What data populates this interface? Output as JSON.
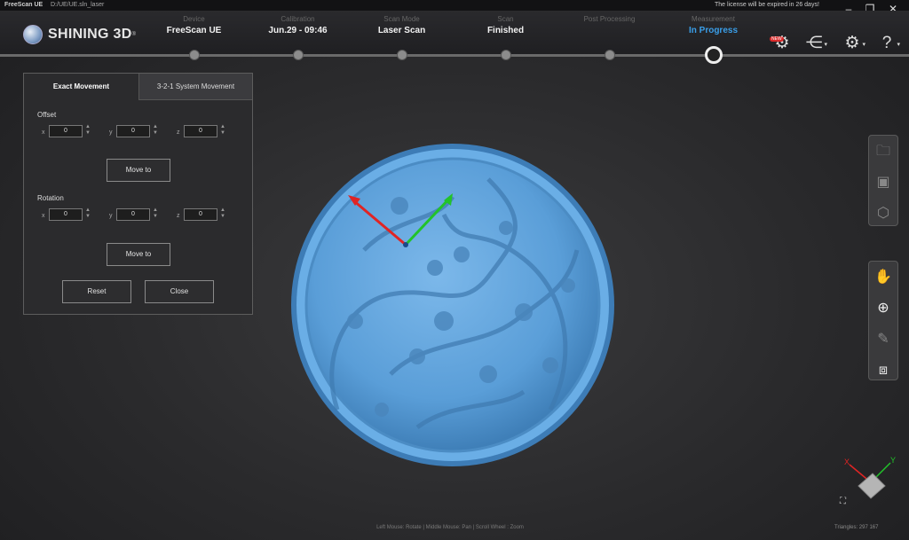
{
  "titlebar": {
    "app_name": "FreeScan UE",
    "project_path": "D:/UE/UE.sln_laser",
    "license_notice": "The license will be expired in 26 days!"
  },
  "brand": {
    "name": "SHINING 3D",
    "trademark": "®"
  },
  "steps": [
    {
      "label": "Device",
      "value": "FreeScan UE"
    },
    {
      "label": "Calibration",
      "value": "Jun.29 - 09:46"
    },
    {
      "label": "Scan Mode",
      "value": "Laser Scan"
    },
    {
      "label": "Scan",
      "value": "Finished"
    },
    {
      "label": "Post Processing",
      "value": ""
    },
    {
      "label": "Measurement",
      "value": "In Progress"
    }
  ],
  "header_icons": {
    "new_badge": "NEW"
  },
  "panel": {
    "tabs": [
      "Exact Movement",
      "3-2-1 System  Movement"
    ],
    "offset_label": "Offset",
    "rotation_label": "Rotation",
    "axis_labels": [
      "x",
      "y",
      "z"
    ],
    "offset_values": [
      "0",
      "0",
      "0"
    ],
    "rotation_values": [
      "0",
      "0",
      "0"
    ],
    "move_to_label": "Move to",
    "reset_label": "Reset",
    "close_label": "Close"
  },
  "viewport": {
    "hint": "Left Mouse: Rotate | Middle Mouse: Pan | Scroll Wheel : Zoom",
    "triangles": "Triangles: 297 167",
    "axis_x": "X",
    "axis_y": "Y"
  },
  "colors": {
    "accent": "#3a9ee8",
    "model_blue": "#5fa3dd",
    "axis_red": "#e02424",
    "axis_green": "#22c32a"
  }
}
